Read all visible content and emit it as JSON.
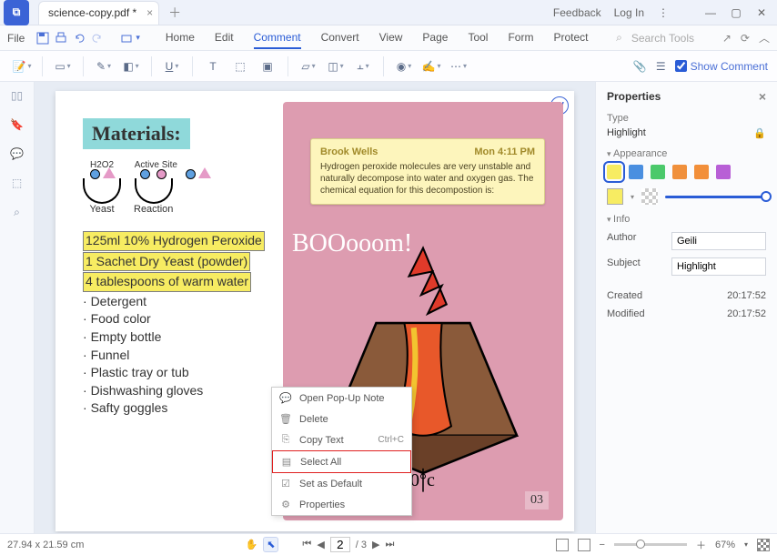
{
  "titlebar": {
    "tab_title": "science-copy.pdf *",
    "feedback": "Feedback",
    "login": "Log In"
  },
  "menubar": {
    "file": "File",
    "tabs": [
      "Home",
      "Edit",
      "Comment",
      "Convert",
      "View",
      "Page",
      "Tool",
      "Form",
      "Protect"
    ],
    "active_tab": "Comment",
    "search_placeholder": "Search Tools"
  },
  "toolbar": {
    "show_comment": "Show Comment"
  },
  "document": {
    "materials_title": "Materials:",
    "chem_labels": {
      "h2o2": "H2O2",
      "active_site": "Active Site",
      "yeast": "Yeast",
      "reaction": "Reaction"
    },
    "highlighted": [
      "125ml 10% Hydrogen Peroxide",
      "1 Sachet Dry Yeast (powder)",
      "4 tablespoons of warm water"
    ],
    "bullets": [
      "Detergent",
      "Food color",
      "Empty bottle",
      "Funnel",
      "Plastic tray or tub",
      "Dishwashing gloves",
      "Safty goggles"
    ],
    "boom": "BOOooom!",
    "temp": "4400°c",
    "pagenum": "03",
    "sticky": {
      "author": "Brook Wells",
      "time": "Mon 4:11 PM",
      "body": "Hydrogen peroxide molecules are very unstable and naturally decompose into water and oxygen gas. The chemical equation for this decompostion is:"
    }
  },
  "context_menu": {
    "items": [
      {
        "icon": "💬",
        "label": "Open Pop-Up Note"
      },
      {
        "icon": "🗑",
        "label": "Delete"
      },
      {
        "icon": "⎘",
        "label": "Copy Text",
        "shortcut": "Ctrl+C"
      },
      {
        "icon": "▤",
        "label": "Select All",
        "highlight": true
      },
      {
        "icon": "☑",
        "label": "Set as Default"
      },
      {
        "icon": "⚙",
        "label": "Properties"
      }
    ]
  },
  "properties": {
    "title": "Properties",
    "type_label": "Type",
    "type_value": "Highlight",
    "appearance_label": "Appearance",
    "swatches": [
      "#f7ec62",
      "#4a8fe0",
      "#4bc96b",
      "#f0903c",
      "#f28f3a",
      "#b85fd6"
    ],
    "info_label": "Info",
    "author_label": "Author",
    "author_value": "Geili",
    "subject_label": "Subject",
    "subject_value": "Highlight",
    "created_label": "Created",
    "created_value": "20:17:52",
    "modified_label": "Modified",
    "modified_value": "20:17:52"
  },
  "statusbar": {
    "dimensions": "27.94 x 21.59 cm",
    "page_current": "2",
    "page_total": "/ 3",
    "zoom": "67%"
  }
}
